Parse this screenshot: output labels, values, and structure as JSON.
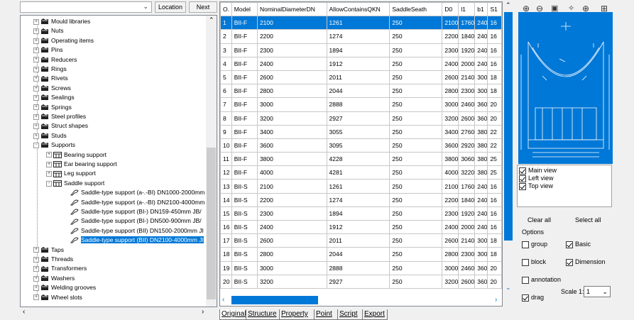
{
  "toolbar": {
    "search_value": "",
    "location_label": "Location",
    "next_label": "Next"
  },
  "tree": {
    "items": [
      "Mould libraries",
      "Nuts",
      "Operating items",
      "Pins",
      "Reducers",
      "Rings",
      "Rivets",
      "Screws",
      "Sealings",
      "Springs",
      "Steel profiles",
      "Struct shapes",
      "Studs",
      "Supports"
    ],
    "support_children": [
      "Bearing support",
      "Ear bearing support",
      "Leg support",
      "Saddle support"
    ],
    "saddle_children": [
      "Saddle-type support (a-.-BI) DN1000-2000mm",
      "Saddle-type support (a-.-BI) DN2100-4000mm",
      "Saddle-type support (BI-) DN159-450mm JB/",
      "Saddle-type support (BI-) DN500-900mm JB/",
      "Saddle-type support (BII) DN1500-2000mm JI",
      "Saddle-type support (BII) DN2100-4000mm JI"
    ],
    "items_after": [
      "Taps",
      "Threads",
      "Transformers",
      "Washers",
      "Welding grooves",
      "Wheel slots"
    ]
  },
  "grid": {
    "columns": [
      "O.",
      "Model",
      "NominalDiameterDN",
      "AllowContainsQKN",
      "SaddleSeath",
      "D0",
      "l1",
      "b1",
      "S1"
    ],
    "rows": [
      [
        "1",
        "BII-F",
        "2100",
        "1261",
        "250",
        "2100",
        "1760",
        "240",
        "16"
      ],
      [
        "2",
        "BII-F",
        "2200",
        "1274",
        "250",
        "2200",
        "1840",
        "240",
        "16"
      ],
      [
        "3",
        "BII-F",
        "2300",
        "1894",
        "250",
        "2300",
        "1920",
        "240",
        "16"
      ],
      [
        "4",
        "BII-F",
        "2400",
        "1912",
        "250",
        "2400",
        "2000",
        "240",
        "16"
      ],
      [
        "5",
        "BII-F",
        "2600",
        "2011",
        "250",
        "2600",
        "2140",
        "300",
        "18"
      ],
      [
        "6",
        "BII-F",
        "2800",
        "2044",
        "250",
        "2800",
        "2300",
        "300",
        "18"
      ],
      [
        "7",
        "BII-F",
        "3000",
        "2888",
        "250",
        "3000",
        "2460",
        "360",
        "20"
      ],
      [
        "8",
        "BII-F",
        "3200",
        "2927",
        "250",
        "3200",
        "2600",
        "360",
        "20"
      ],
      [
        "9",
        "BII-F",
        "3400",
        "3055",
        "250",
        "3400",
        "2760",
        "380",
        "22"
      ],
      [
        "10",
        "BII-F",
        "3600",
        "3095",
        "250",
        "3600",
        "2920",
        "380",
        "22"
      ],
      [
        "11",
        "BII-F",
        "3800",
        "4228",
        "250",
        "3800",
        "3060",
        "380",
        "25"
      ],
      [
        "12",
        "BII-F",
        "4000",
        "4281",
        "250",
        "4000",
        "3220",
        "380",
        "25"
      ],
      [
        "13",
        "BII-S",
        "2100",
        "1261",
        "250",
        "2100",
        "1760",
        "240",
        "16"
      ],
      [
        "14",
        "BII-S",
        "2200",
        "1274",
        "250",
        "2200",
        "1840",
        "240",
        "16"
      ],
      [
        "15",
        "BII-S",
        "2300",
        "1894",
        "250",
        "2300",
        "1920",
        "240",
        "16"
      ],
      [
        "16",
        "BII-S",
        "2400",
        "1912",
        "250",
        "2400",
        "2000",
        "240",
        "16"
      ],
      [
        "17",
        "BII-S",
        "2600",
        "2011",
        "250",
        "2600",
        "2140",
        "300",
        "18"
      ],
      [
        "18",
        "BII-S",
        "2800",
        "2044",
        "250",
        "2800",
        "2300",
        "300",
        "18"
      ],
      [
        "19",
        "BII-S",
        "3000",
        "2888",
        "250",
        "3000",
        "2460",
        "360",
        "20"
      ],
      [
        "20",
        "BII-S",
        "3200",
        "2927",
        "250",
        "3200",
        "2600",
        "360",
        "20"
      ]
    ]
  },
  "tabs": [
    "Original",
    "Structure",
    "Property",
    "Point",
    "Script",
    "Export"
  ],
  "views": {
    "main": "Main view",
    "left": "Left view",
    "top": "Top view"
  },
  "actions": {
    "clear_all": "Clear all",
    "select_all": "Select all"
  },
  "options": {
    "label": "Options",
    "group": "group",
    "basic": "Basic",
    "block": "block",
    "dimension": "Dimension",
    "annotation": "annotation",
    "drag": "drag",
    "scale_label": "Scale 1:",
    "scale_value": "1"
  },
  "colors": {
    "selection": "#0078d7"
  }
}
